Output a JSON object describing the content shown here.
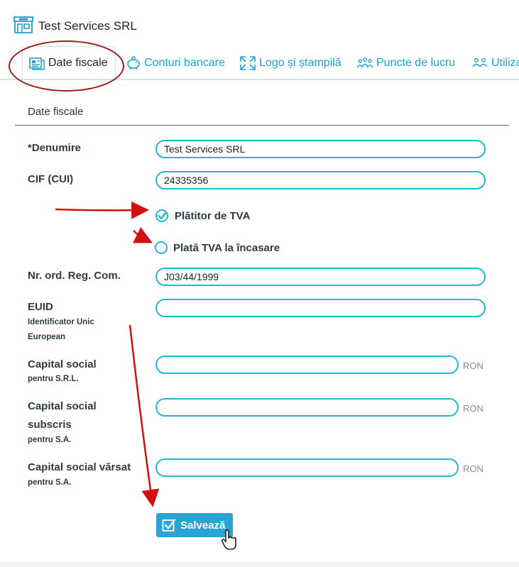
{
  "company": {
    "name": "Test Services SRL",
    "icon": "storefront-icon"
  },
  "tabs": [
    {
      "label": "Date fiscale",
      "icon": "document-icon",
      "active": true
    },
    {
      "label": "Conturi bancare",
      "icon": "piggy-bank-icon"
    },
    {
      "label": "Logo și ștampilă",
      "icon": "image-expand-icon"
    },
    {
      "label": "Puncte de lucru",
      "icon": "people-group-icon"
    },
    {
      "label": "Utiliza",
      "icon": "users-icon"
    }
  ],
  "section": {
    "title": "Date fiscale"
  },
  "form": {
    "denumire": {
      "required_mark": "*",
      "label": "Denumire",
      "value": "Test Services SRL"
    },
    "cif": {
      "label": "CIF (CUI)",
      "value": "24335356"
    },
    "platitor_tva": {
      "label": "Plătitor de TVA",
      "checked": true
    },
    "plata_tva": {
      "label": "Plată TVA la încasare",
      "checked": false
    },
    "nr_ord": {
      "label": "Nr. ord. Reg. Com.",
      "value": "J03/44/1999"
    },
    "euid": {
      "label": "EUID",
      "sub1": "Identificator Unic",
      "sub2": "European",
      "value": ""
    },
    "capital_srl": {
      "label": "Capital social",
      "sub": "pentru S.R.L.",
      "value": "",
      "unit": "RON"
    },
    "capital_subscris": {
      "label1": "Capital social",
      "label2": "subscris",
      "sub": "pentru S.A.",
      "value": "",
      "unit": "RON"
    },
    "capital_varsat": {
      "label": "Capital social vărsat",
      "sub": "pentru S.A.",
      "value": "",
      "unit": "RON"
    }
  },
  "save_button": {
    "label": "Salvează"
  },
  "colors": {
    "accent": "#23b7d8",
    "tab_text": "#1aa3c9",
    "button": "#2aa4d3",
    "annotation": "#d40f0f"
  }
}
